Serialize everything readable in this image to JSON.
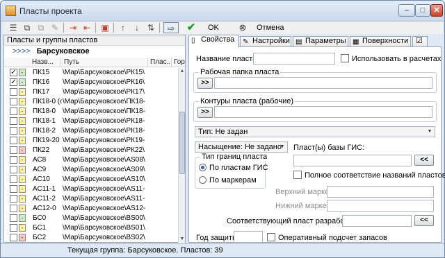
{
  "window": {
    "title": "Пласты проекта"
  },
  "toolbar": {
    "ok_label": "OK",
    "cancel_label": "Отмена"
  },
  "left": {
    "header": "Пласты и группы пластов",
    "group_arrows": ">>>>",
    "group_name": "Барсуковское",
    "columns": [
      "Назв...",
      "Путь",
      "Плас...",
      "Гор"
    ],
    "rows": [
      {
        "checked": true,
        "color": "green",
        "name": "ПК15",
        "path": "\\Мар\\Барсуковское\\РК15\\"
      },
      {
        "checked": true,
        "color": "green",
        "name": "ПК16",
        "path": "\\Мар\\Барсуковское\\РК16\\"
      },
      {
        "checked": false,
        "color": "yellow",
        "name": "ПК17",
        "path": "\\Мар\\Барсуковское\\РК17\\"
      },
      {
        "checked": false,
        "color": "yellow",
        "name": "ПК18-0 (о",
        "path": "\\Мар\\Барсуковское\\ПК18-"
      },
      {
        "checked": false,
        "color": "yellow",
        "name": "ПК18-0",
        "path": "\\Мар\\Барсуковское\\ПК18-"
      },
      {
        "checked": false,
        "color": "yellow",
        "name": "ПК18-1",
        "path": "\\Мар\\Барсуковское\\РК18-"
      },
      {
        "checked": false,
        "color": "yellow",
        "name": "ПК18-2",
        "path": "\\Мар\\Барсуковское\\РК18-"
      },
      {
        "checked": false,
        "color": "yellow",
        "name": "ПК19-20",
        "path": "\\Мар\\Барсуковское\\РК19-"
      },
      {
        "checked": false,
        "color": "red",
        "name": "ПК22",
        "path": "\\Мар\\Барсуковское\\РК22\\"
      },
      {
        "checked": false,
        "color": "yellow",
        "name": "АС8",
        "path": "\\Мар\\Барсуковское\\AS08\\"
      },
      {
        "checked": false,
        "color": "yellow",
        "name": "АС9",
        "path": "\\Мар\\Барсуковское\\AS09\\"
      },
      {
        "checked": false,
        "color": "yellow",
        "name": "АС10",
        "path": "\\Мар\\Барсуковское\\AS10\\"
      },
      {
        "checked": false,
        "color": "yellow",
        "name": "АС11-1",
        "path": "\\Мар\\Барсуковское\\AS11-"
      },
      {
        "checked": false,
        "color": "yellow",
        "name": "АС11-2",
        "path": "\\Мар\\Барсуковское\\AS11-"
      },
      {
        "checked": false,
        "color": "yellow",
        "name": "АС12-0",
        "path": "\\Мар\\Барсуковское\\AS12-"
      },
      {
        "checked": false,
        "color": "green",
        "name": "БС0",
        "path": "\\Мар\\Барсуковское\\BS00\\"
      },
      {
        "checked": false,
        "color": "yellow",
        "name": "БС1",
        "path": "\\Мар\\Барсуковское\\BS01\\"
      },
      {
        "checked": false,
        "color": "red",
        "name": "БС2",
        "path": "\\Мар\\Барсуковское\\BS02\\"
      }
    ]
  },
  "tabs": [
    "Свойства",
    "Настройки",
    "Параметры",
    "Поверхности"
  ],
  "props": {
    "name_label": "Название пласта:",
    "use_in_calc": "Использовать в расчетах",
    "work_folder_label": "Рабочая папка пласта",
    "contours_label": "Контуры пласта (рабочие)",
    "browse_btn": ">>",
    "type_value": "Тип: Не задан",
    "saturation_value": "Насыщение: Не задано",
    "gis_label": "Пласт(ы) базы ГИС:",
    "back_btn": "<<",
    "boundary_group": "Тип границ пласта",
    "radio_gis": "По пластам ГИС",
    "radio_markers": "По маркерам",
    "full_match": "Полное соответствие названий пластов",
    "top_marker": "Верхний маркер:",
    "bottom_marker": "Нижний маркер:",
    "dev_layer": "Соответствующий пласт разработки",
    "year_label": "Год защиты",
    "op_reserves": "Оперативный подсчет запасов"
  },
  "status": "Текущая группа: Барсуковское. Пластов: 39"
}
